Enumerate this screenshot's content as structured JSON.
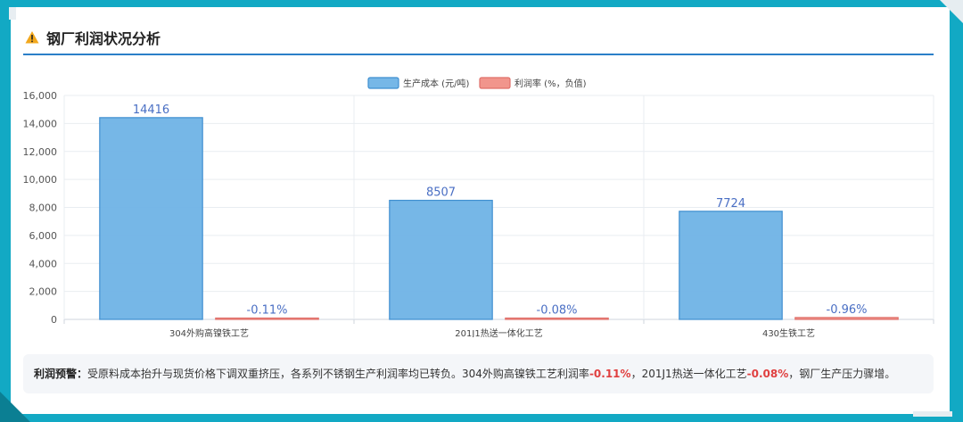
{
  "header": {
    "title": "钢厂利润状况分析"
  },
  "chart_data": {
    "type": "bar",
    "categories": [
      "304外购高镍铁工艺",
      "201J1热送一体化工艺",
      "430生铁工艺"
    ],
    "series": [
      {
        "name": "生产成本 (元/吨)",
        "values": [
          14416,
          8507,
          7724
        ],
        "labels": [
          "14416",
          "8507",
          "7724"
        ]
      },
      {
        "name": "利润率 (%，负值)",
        "values": [
          -0.11,
          -0.08,
          -0.96
        ],
        "labels": [
          "-0.11%",
          "-0.08%",
          "-0.96%"
        ]
      }
    ],
    "yticks": [
      "0",
      "2,000",
      "4,000",
      "6,000",
      "8,000",
      "10,000",
      "12,000",
      "14,000",
      "16,000"
    ],
    "ylim": [
      0,
      16000
    ],
    "grid": true,
    "legend": "top-center",
    "colors": [
      "#6fb3e6",
      "#f08a80"
    ]
  },
  "note": {
    "label": "利润预警：",
    "t1": "受原料成本抬升与现货价格下调双重挤压，各系列不锈钢生产利润率均已转负。304外购高镍铁工艺利润率",
    "v1": "-0.11%",
    "t2": "，201J1热送一体化工艺",
    "v2": "-0.08%",
    "t3": "，钢厂生产压力骤增。"
  }
}
